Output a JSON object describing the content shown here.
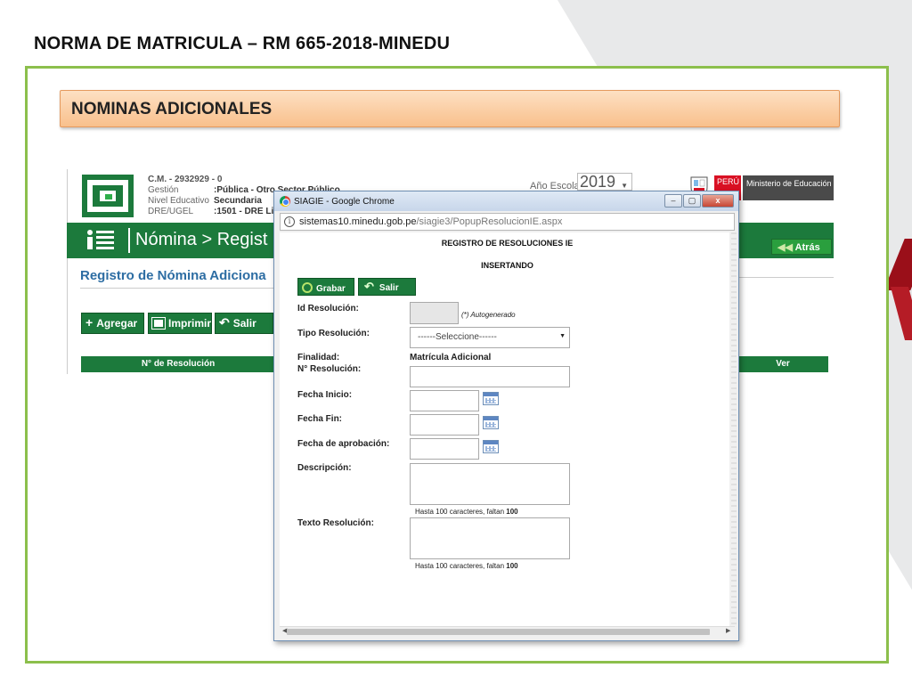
{
  "slide": {
    "title": "NORMA DE MATRICULA – RM 665-2018-MINEDU",
    "banner": "NOMINAS ADICIONALES"
  },
  "background_page": {
    "info": {
      "cm": "C.M. - 2932929 - 0",
      "gestion_label": "Gestión",
      "gestion_value": ":Pública - Otro Sector Público",
      "nivel_label": "Nivel Educativo",
      "nivel_value": "Secundaria",
      "dre_label": "DRE/UGEL",
      "dre_value": ":1501 - DRE Li"
    },
    "year_label": "Año Escolar",
    "year_value": "2019",
    "peru_label": "PERÚ",
    "ministry_label": "Ministerio de Educación",
    "header_title": "Nómina > Regist",
    "back_button": "Atrás",
    "subtitle": "Registro de Nómina Adiciona",
    "toolbar": {
      "add": "Agregar",
      "print": "Imprimir",
      "exit": "Salir"
    },
    "table_header_left": "N° de Resolución",
    "table_header_right": "Ver"
  },
  "popup": {
    "window_title": "SIAGIE - Google Chrome",
    "url_host": "sistemas10.minedu.gob.pe",
    "url_path": "/siagie3/PopupResolucionIE.aspx",
    "form_title": "REGISTRO DE RESOLUCIONES IE",
    "form_mode": "INSERTANDO",
    "save_button": "Grabar",
    "exit_button": "Salir",
    "fields": {
      "id_label": "Id Resolución:",
      "id_hint": "(*) Autogenerado",
      "tipo_label": "Tipo Resolución:",
      "tipo_value": "------Seleccione------",
      "finalidad_label": "Finalidad:",
      "finalidad_value": "Matrícula Adicional",
      "numero_label": "N° Resolución:",
      "inicio_label": "Fecha Inicio:",
      "fin_label": "Fecha Fin:",
      "aprobacion_label": "Fecha de aprobación:",
      "descripcion_label": "Descripción:",
      "texto_label": "Texto Resolución:"
    },
    "hint_prefix": "Hasta 100 caracteres, faltan ",
    "hint_count": "100"
  }
}
